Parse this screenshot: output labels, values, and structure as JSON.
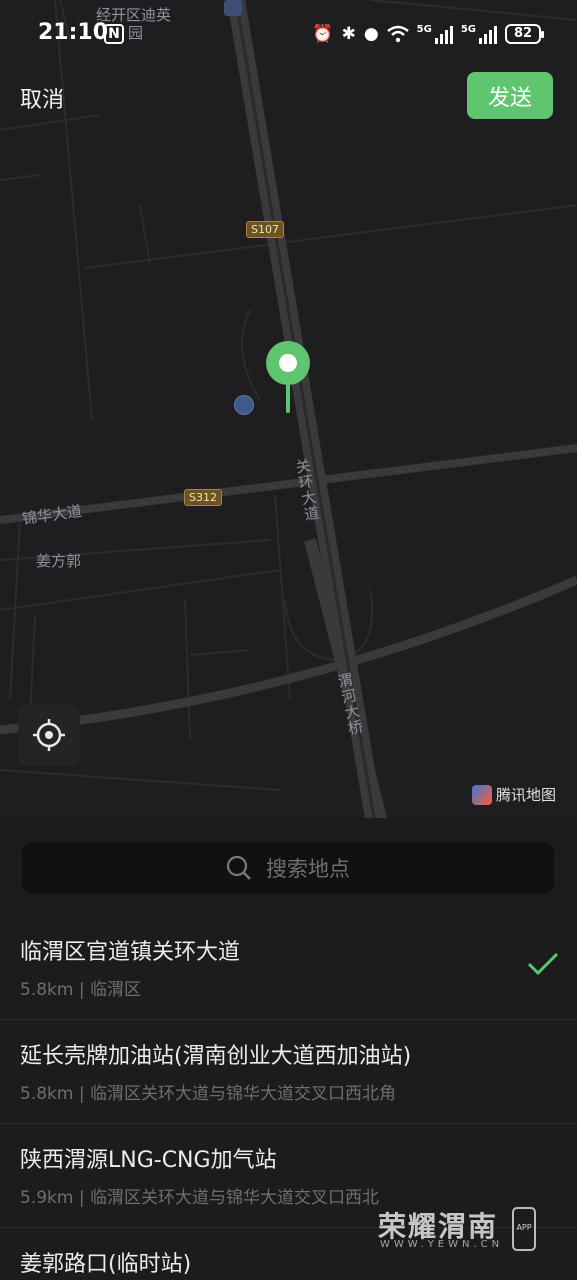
{
  "status_bar": {
    "time": "21:10",
    "nfc": "N",
    "signal1": "5G",
    "signal2": "5G",
    "battery": "82"
  },
  "header": {
    "cancel_label": "取消",
    "send_label": "发送"
  },
  "map": {
    "labels": {
      "poi_top": "经开区迪英",
      "poi_top2": "园",
      "road_jinhua": "锦华大道",
      "area_jiangfang": "姜方郭",
      "road_guanhuan": "关环大道",
      "bridge_weihe": "渭河大桥"
    },
    "shields": {
      "s107": "S107",
      "s312": "S312"
    },
    "provider": "腾讯地图",
    "pin_color": "#5fc66f"
  },
  "search": {
    "placeholder": "搜索地点"
  },
  "results": [
    {
      "name": "临渭区官道镇关环大道",
      "sub": "5.8km | 临渭区",
      "selected": true
    },
    {
      "name": "延长壳牌加油站(渭南创业大道西加油站)",
      "sub": "5.8km | 临渭区关环大道与锦华大道交叉口西北角",
      "selected": false
    },
    {
      "name": "陕西渭源LNG-CNG加气站",
      "sub": "5.9km | 临渭区关环大道与锦华大道交叉口西北",
      "selected": false
    },
    {
      "name": "姜郭路口(临时站)",
      "sub": "",
      "selected": false
    }
  ],
  "watermark": {
    "title": "荣耀渭南",
    "url": "WWW.YEWN.CN",
    "app": "APP"
  },
  "colors": {
    "accent": "#5fc66f",
    "background": "#1a1a1a"
  }
}
